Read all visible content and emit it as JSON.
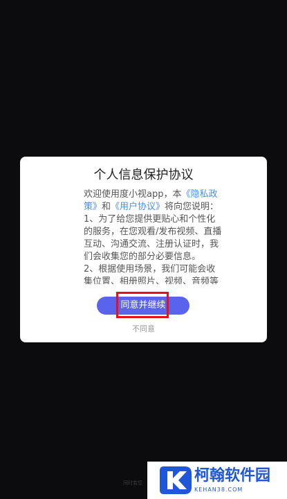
{
  "dialog": {
    "title": "个人信息保护协议",
    "body": {
      "intro_prefix": "欢迎使用度小视app，本",
      "privacy_link": "《隐私政策》",
      "intro_middle": "和",
      "user_link": "《用户协议》",
      "intro_suffix": "将向您说明：",
      "item1": "1、为了给您提供更贴心和个性化的服务，在您观看/发布视频、直播互动、沟通交流、注册认证时，我们会收集您的部分必要信息。",
      "item2": "2、根据使用场景，我们可能会收集位置、相册照片、视频、音频等"
    },
    "agree_label": "同意并继续",
    "disagree_label": "不同意"
  },
  "background": {
    "faint_text": "同时若您"
  },
  "watermark": {
    "name": "柯翰软件园",
    "url": "KEHAN38.COM"
  },
  "colors": {
    "accent": "#5a63ec",
    "link": "#4a8cf0",
    "highlight": "#e60f1b",
    "watermark": "#1f57d8"
  }
}
